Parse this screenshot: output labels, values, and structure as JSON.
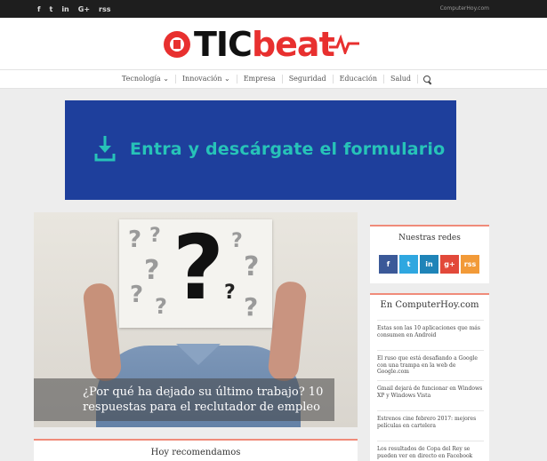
{
  "topbar": {
    "social": [
      "f",
      "t",
      "in",
      "G+",
      "rss"
    ],
    "site": "ComputerHoy.com"
  },
  "logo": {
    "part1": "TIC",
    "part2": "beat"
  },
  "nav": {
    "items": [
      "Tecnología ⌄",
      "Innovación ⌄",
      "Empresa",
      "Seguridad",
      "Educación",
      "Salud"
    ],
    "search_icon": "search-icon"
  },
  "banner": {
    "text": "Entra y descárgate el formulario",
    "icon": "download-icon",
    "bg": "#1e3f9c",
    "fg": "#27c3b8"
  },
  "hero": {
    "title_line1": "¿Por qué ha dejado su último trabajo? 10",
    "title_line2": "respuestas para el reclutador de empleo"
  },
  "redes": {
    "title": "Nuestras redes",
    "icons": [
      {
        "glyph": "f",
        "name": "facebook-icon",
        "color": "#3b5998"
      },
      {
        "glyph": "t",
        "name": "twitter-icon",
        "color": "#2fa7e0"
      },
      {
        "glyph": "in",
        "name": "linkedin-icon",
        "color": "#1f84b8"
      },
      {
        "glyph": "g+",
        "name": "google-plus-icon",
        "color": "#e2493a"
      },
      {
        "glyph": "rss",
        "name": "rss-icon",
        "color": "#f29a38"
      }
    ]
  },
  "computerhoy": {
    "title": "En ComputerHoy.com",
    "items": [
      "Estas son las 10 aplicaciones que más consumen en Android",
      "El ruso que está desafiando a Google con una trampa en la web de Google.com",
      "Gmail dejará de funcionar en Windows XP y Windows Vista",
      "Estrenos cine febrero 2017: mejores películas en cartelera",
      "Los resultados de Copa del Rey se pueden ver en directo en Facebook"
    ]
  },
  "recomendamos": {
    "title": "Hoy recomendamos"
  }
}
